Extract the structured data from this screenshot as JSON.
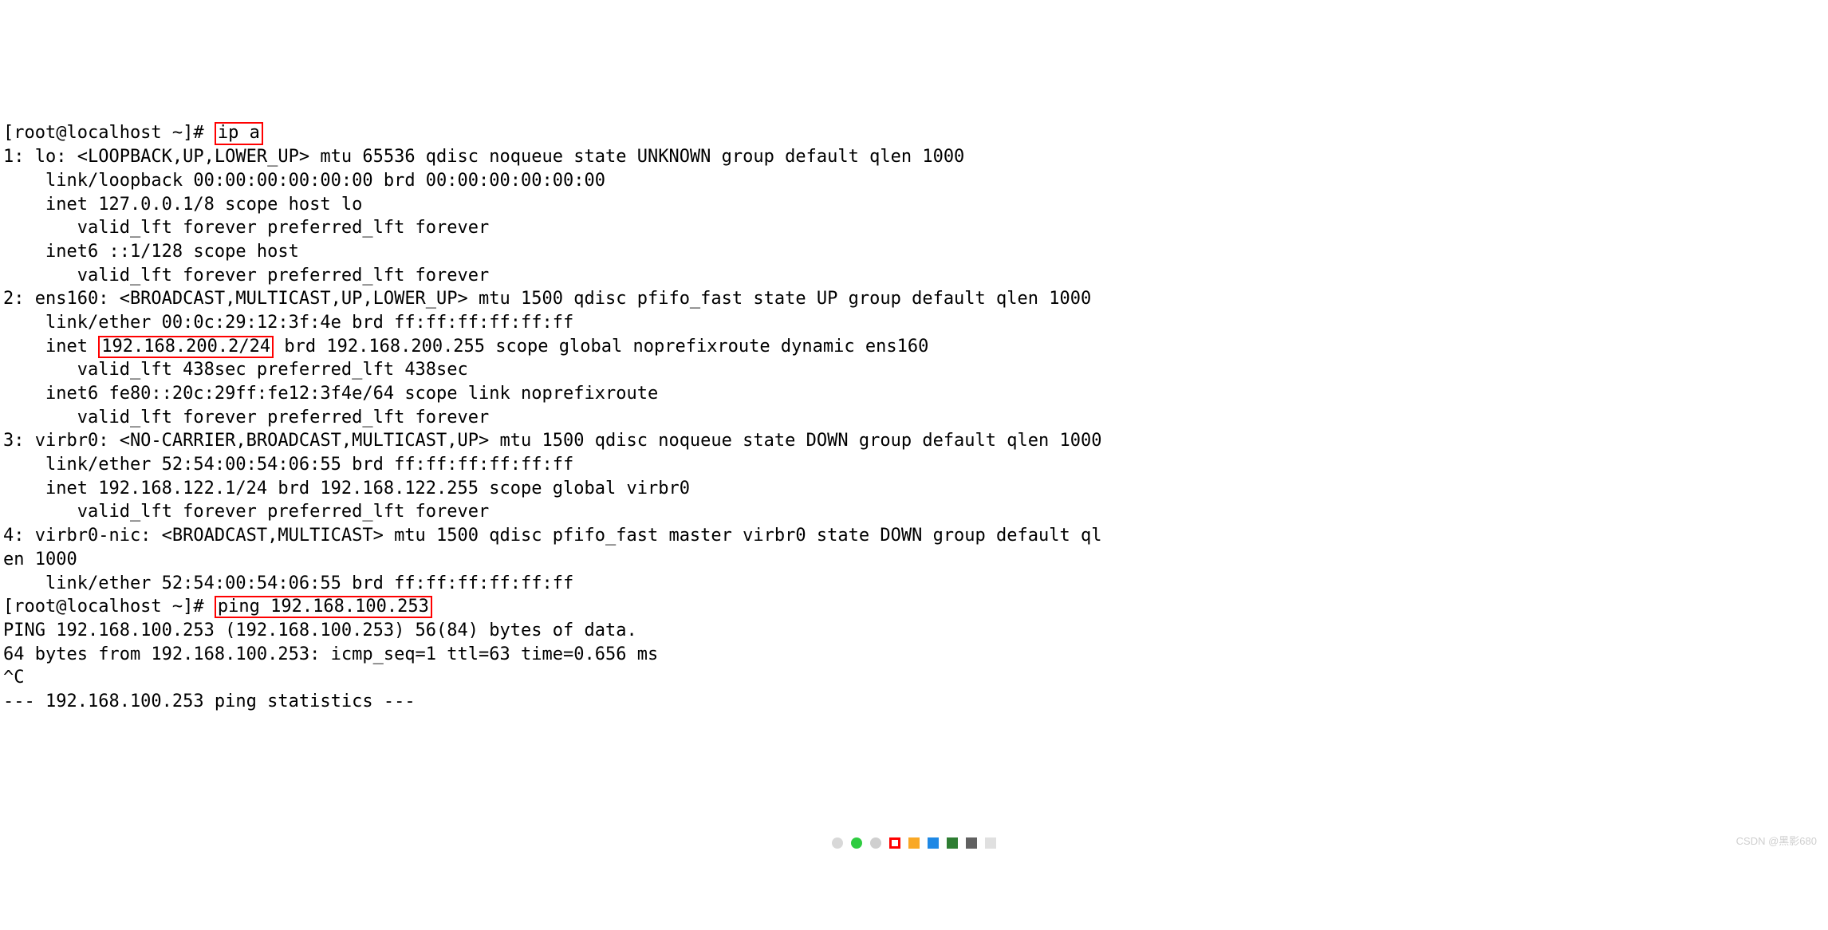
{
  "prompt1_prefix": "[root@localhost ~]# ",
  "cmd1": "ip a",
  "if1": {
    "header": "1: lo: <LOOPBACK,UP,LOWER_UP> mtu 65536 qdisc noqueue state UNKNOWN group default qlen 1000",
    "link": "    link/loopback 00:00:00:00:00:00 brd 00:00:00:00:00:00",
    "inet": "    inet 127.0.0.1/8 scope host lo",
    "valid1": "       valid_lft forever preferred_lft forever",
    "inet6": "    inet6 ::1/128 scope host",
    "valid2": "       valid_lft forever preferred_lft forever"
  },
  "if2": {
    "header": "2: ens160: <BROADCAST,MULTICAST,UP,LOWER_UP> mtu 1500 qdisc pfifo_fast state UP group default qlen 1000",
    "link": "    link/ether 00:0c:29:12:3f:4e brd ff:ff:ff:ff:ff:ff",
    "inet_pre": "    inet ",
    "inet_ip": "192.168.200.2/24",
    "inet_post": " brd 192.168.200.255 scope global noprefixroute dynamic ens160",
    "valid1": "       valid_lft 438sec preferred_lft 438sec",
    "inet6": "    inet6 fe80::20c:29ff:fe12:3f4e/64 scope link noprefixroute",
    "valid2": "       valid_lft forever preferred_lft forever"
  },
  "if3": {
    "header": "3: virbr0: <NO-CARRIER,BROADCAST,MULTICAST,UP> mtu 1500 qdisc noqueue state DOWN group default qlen 1000",
    "link": "    link/ether 52:54:00:54:06:55 brd ff:ff:ff:ff:ff:ff",
    "inet": "    inet 192.168.122.1/24 brd 192.168.122.255 scope global virbr0",
    "valid1": "       valid_lft forever preferred_lft forever"
  },
  "if4": {
    "header_a": "4: virbr0-nic: <BROADCAST,MULTICAST> mtu 1500 qdisc pfifo_fast master virbr0 state DOWN group default ql",
    "header_b": "en 1000",
    "link": "    link/ether 52:54:00:54:06:55 brd ff:ff:ff:ff:ff:ff"
  },
  "prompt2_prefix": "[root@localhost ~]# ",
  "cmd2": "ping 192.168.100.253",
  "ping": {
    "l1": "PING 192.168.100.253 (192.168.100.253) 56(84) bytes of data.",
    "l2": "64 bytes from 192.168.100.253: icmp_seq=1 ttl=63 time=0.656 ms",
    "l3": "^C",
    "l4": "--- 192.168.100.253 ping statistics ---"
  },
  "dots_colors": {
    "d1": "#d8d8d8",
    "d2": "#2ecc40",
    "d3": "#cfcfcf",
    "s_outline": "#ff0000",
    "s1": "#f9a825",
    "s2": "#1e88e5",
    "s3": "#2e7d32",
    "s4": "#616161",
    "s5": "#e0e0e0"
  },
  "watermark": "CSDN @黑影680"
}
